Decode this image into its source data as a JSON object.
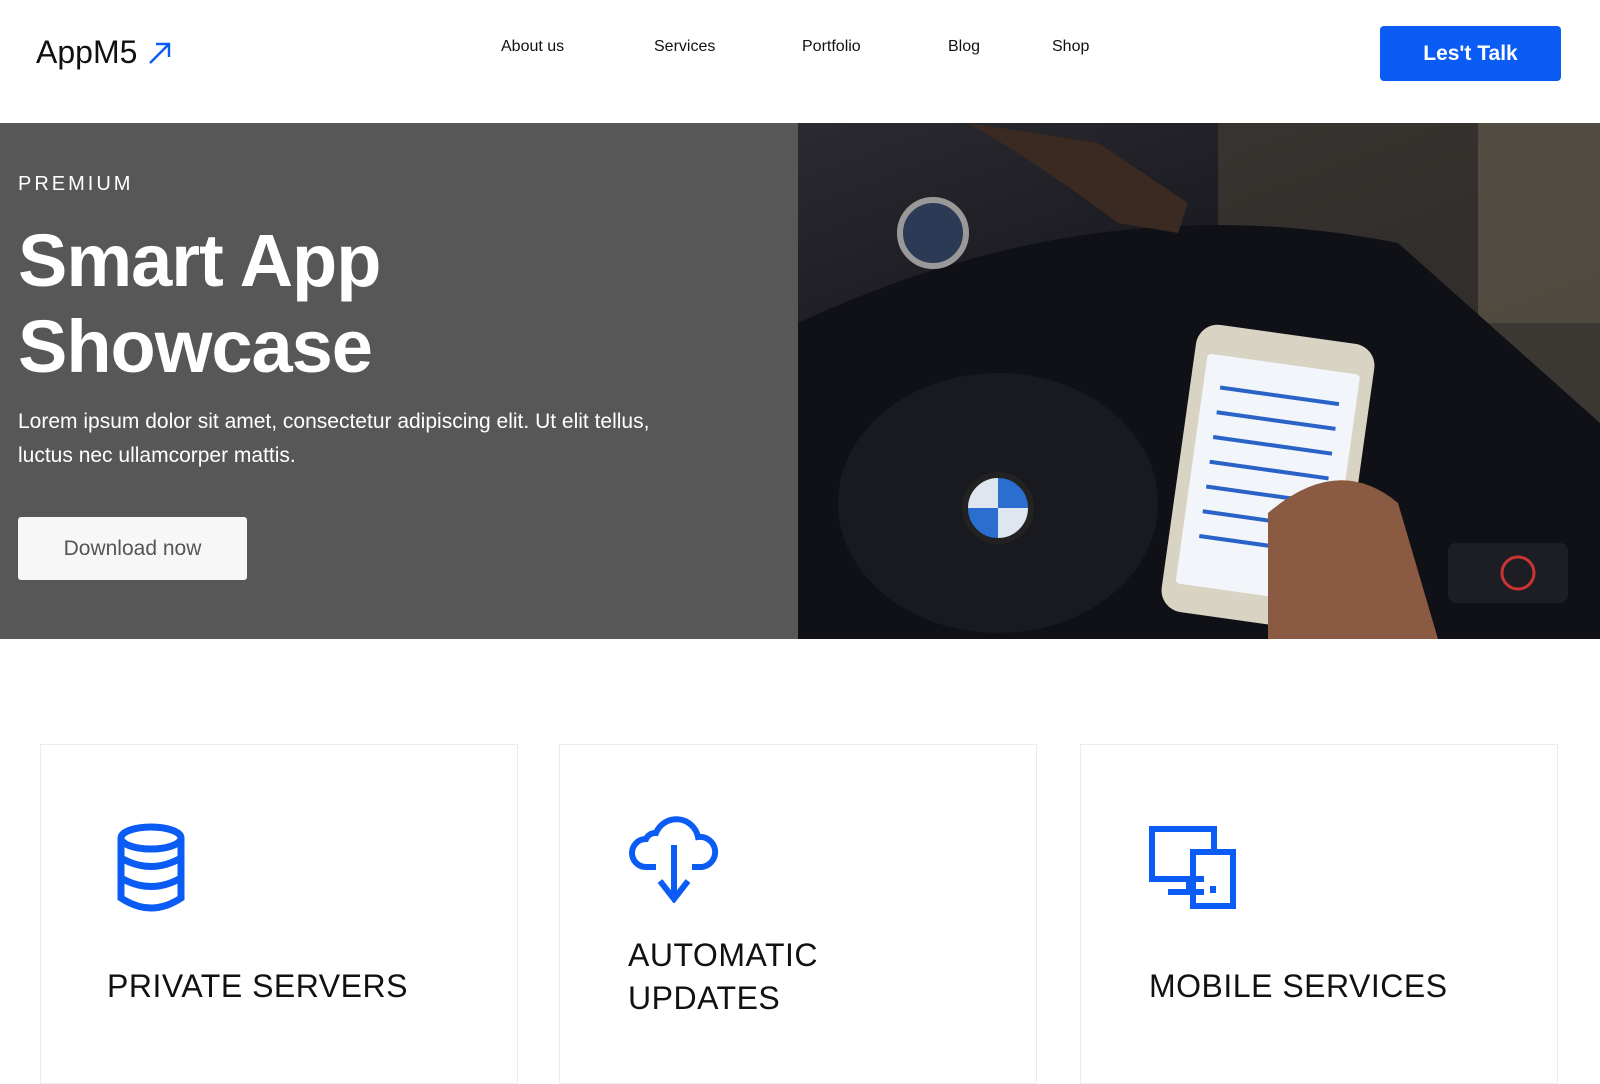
{
  "header": {
    "logo": "AppM5",
    "logo_icon": "arrow-up-right-icon",
    "nav": [
      "About us",
      "Services",
      "Portfolio",
      "Blog",
      "Shop"
    ],
    "cta_label": "Les't Talk"
  },
  "hero": {
    "eyebrow": "PREMIUM",
    "title_line1": "Smart App",
    "title_line2": "Showcase",
    "description": "Lorem ipsum dolor sit amet, consectetur adipiscing elit. Ut elit tellus, luctus nec ullamcorper mattis.",
    "button_label": "Download now",
    "image": "hand holding smartphone with trading app in car"
  },
  "features": [
    {
      "icon": "database-icon",
      "title": "PRIVATE SERVERS"
    },
    {
      "icon": "cloud-download-icon",
      "title": "AUTOMATIC UPDATES"
    },
    {
      "icon": "devices-icon",
      "title": "MOBILE SERVICES"
    }
  ],
  "colors": {
    "accent": "#0a5cf5",
    "hero_bg": "#575757"
  }
}
